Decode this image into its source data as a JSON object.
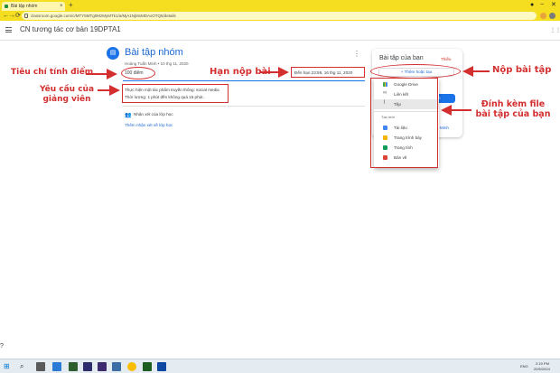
{
  "browser": {
    "tab_title": "Bài tập nhóm",
    "url": "classroom.google.com/c/MTY5MTg0MzMyMTk1/a/MjA1NjMxMDAxOTQ5/details",
    "new_tab": "+",
    "tab_close": "×",
    "minimize": "−",
    "close": "✕",
    "back": "←",
    "forward": "→",
    "reload": "⟳",
    "colors": {
      "bar": "#f5dd1f"
    }
  },
  "app": {
    "class_title": "CN tương tác cơ bản 19DPTA1"
  },
  "assignment": {
    "title": "Bài tập nhóm",
    "meta": "Hoàng Tuấn Minh • 10 thg 11, 2020",
    "points": "100 điểm",
    "due": "Đến hạn 23:59, 16 thg 11, 2020",
    "description_line1": "Thực hiện một tác phẩm truyền thông: social media",
    "description_line2": "Thời lượng: 1 phút đến không quá 15 phút.",
    "comments_label": "Nhận xét của lớp học",
    "add_comment": "Thêm nhận xét về lớp học"
  },
  "your_work": {
    "title": "Bài tập của bạn",
    "status": "Thiếu",
    "add_button": "+ Thêm hoặc tạo",
    "mark_done_fragment": "nh",
    "private_comment_fragment": "Minh",
    "menu_items": [
      {
        "label": "Google Drive",
        "icon": "drive-icon"
      },
      {
        "label": "Liên kết",
        "icon": "link-icon"
      },
      {
        "label": "Tệp",
        "icon": "attach-file-icon"
      }
    ],
    "create_new_label": "Tạo mới",
    "create_items": [
      {
        "label": "Tài liệu",
        "icon": "docs-icon",
        "color": "#4285f4"
      },
      {
        "label": "Trang trình bày",
        "icon": "slides-icon",
        "color": "#f4b400"
      },
      {
        "label": "Trang tính",
        "icon": "sheets-icon",
        "color": "#0f9d58"
      },
      {
        "label": "Bản vẽ",
        "icon": "drawings-icon",
        "color": "#db4437"
      }
    ]
  },
  "annotations": {
    "criteria": "Tiêu chí tính điểm",
    "requirements_line1": "Yêu cầu của",
    "requirements_line2": "giảng viên",
    "deadline": "Hạn nộp bài",
    "submit": "Nộp bài tập",
    "attach_line1": "Đính kèm file",
    "attach_line2": "bài tập của bạn",
    "color": "#d32f2f"
  },
  "taskbar": {
    "search_icon": "search-icon",
    "time": "2:19 PM",
    "date": "20/5/2024",
    "language": "ENG"
  }
}
